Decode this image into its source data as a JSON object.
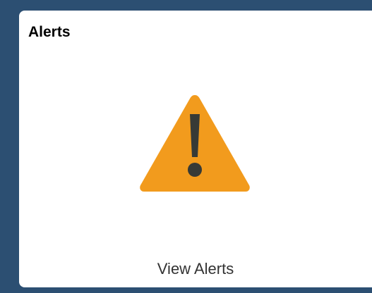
{
  "tile": {
    "title": "Alerts",
    "link_label": "View Alerts",
    "icon": "warning-triangle-icon"
  },
  "colors": {
    "page_background": "#2c4f72",
    "tile_background": "#ffffff",
    "icon_fill": "#f29b1d",
    "icon_mark": "#373a36"
  }
}
